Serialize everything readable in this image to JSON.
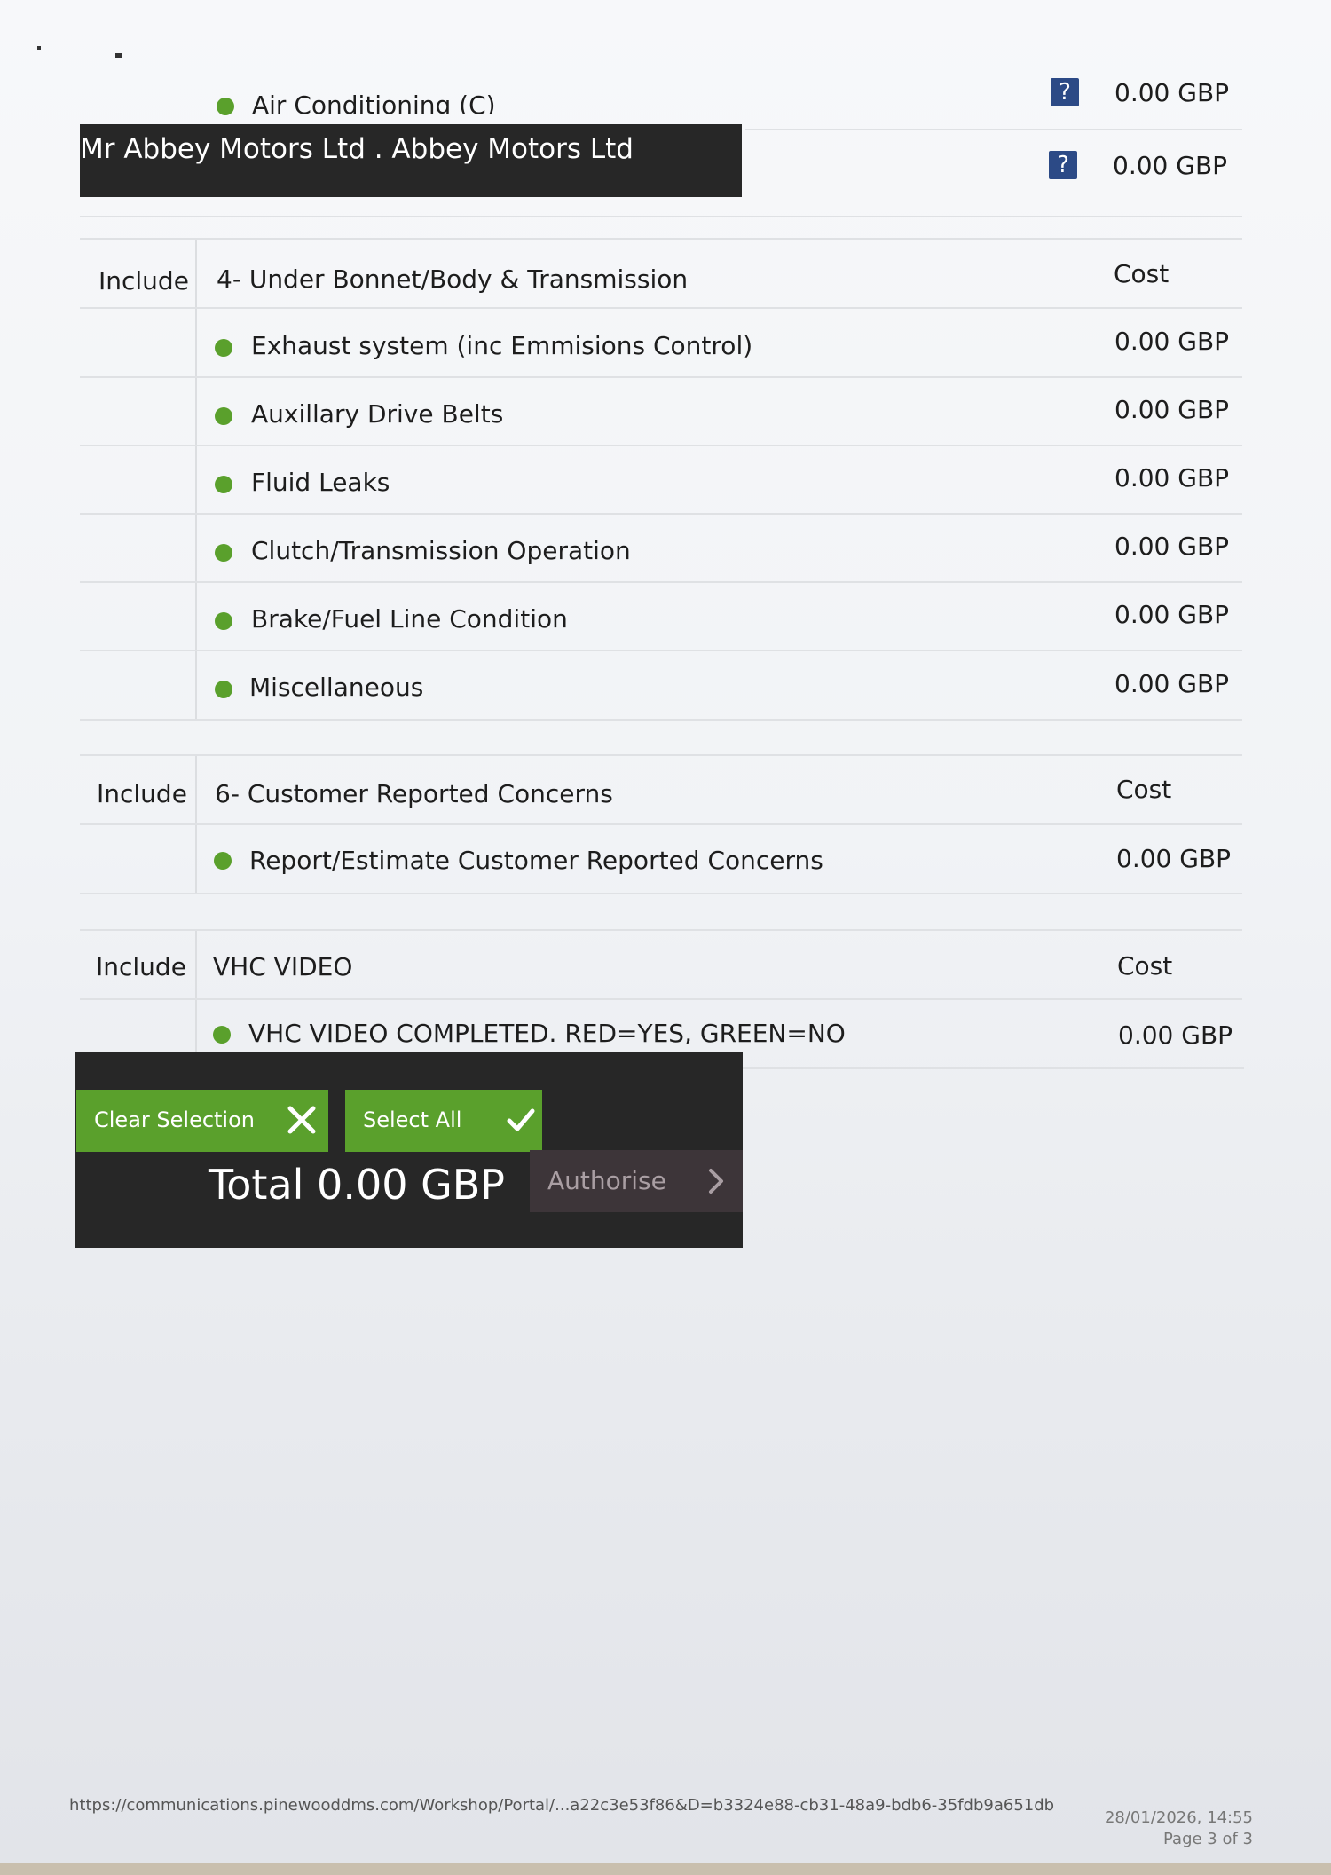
{
  "dealer_banner": "Mr Abbey Motors Ltd . Abbey Motors Ltd",
  "top_items": [
    {
      "label": "Air Conditioning (C)",
      "price": "0.00 GBP"
    },
    {
      "label": "",
      "price": "0.00 GBP"
    }
  ],
  "sections": [
    {
      "include": "Include",
      "title": "4- Under Bonnet/Body & Transmission",
      "cost": "Cost",
      "items": [
        {
          "label": "Exhaust system (inc Emmisions Control)",
          "price": "0.00 GBP",
          "status": "green"
        },
        {
          "label": "Auxillary Drive Belts",
          "price": "0.00 GBP",
          "status": "green"
        },
        {
          "label": "Fluid Leaks",
          "price": "0.00 GBP",
          "status": "green"
        },
        {
          "label": "Clutch/Transmission Operation",
          "price": "0.00 GBP",
          "status": "green"
        },
        {
          "label": "Brake/Fuel Line Condition",
          "price": "0.00 GBP",
          "status": "green"
        },
        {
          "label": "Miscellaneous",
          "price": "0.00 GBP",
          "status": "green"
        }
      ]
    },
    {
      "include": "Include",
      "title": "6- Customer Reported Concerns",
      "cost": "Cost",
      "items": [
        {
          "label": "Report/Estimate Customer Reported Concerns",
          "price": "0.00 GBP",
          "status": "green"
        }
      ]
    },
    {
      "include": "Include",
      "title": "VHC VIDEO",
      "cost": "Cost",
      "items": [
        {
          "label": "VHC VIDEO COMPLETED. RED=YES, GREEN=NO",
          "price": "0.00 GBP",
          "status": "green"
        }
      ]
    }
  ],
  "actions": {
    "clear_label": "Clear Selection",
    "select_all_label": "Select All",
    "total": "Total 0.00 GBP",
    "authorise_label": "Authorise"
  },
  "footer": {
    "url": "https://communications.pinewooddms.com/Workshop/Portal/...a22c3e53f86&D=b3324e88-cb31-48a9-bdb6-35fdb9a651db",
    "datetime": "28/01/2026, 14:55",
    "page": "Page 3 of 3"
  },
  "icons": {
    "status_dot": "green-status-dot",
    "help": "question-mark-icon",
    "clear": "x-icon",
    "select_all": "check-icon",
    "authorise": "chevron-right-icon"
  },
  "colors": {
    "status_green": "#5aa02c",
    "button_green": "#5aa02c",
    "panel_dark": "#272727",
    "help_blue": "#2c4a86",
    "authorise_bg": "#3d3539"
  }
}
